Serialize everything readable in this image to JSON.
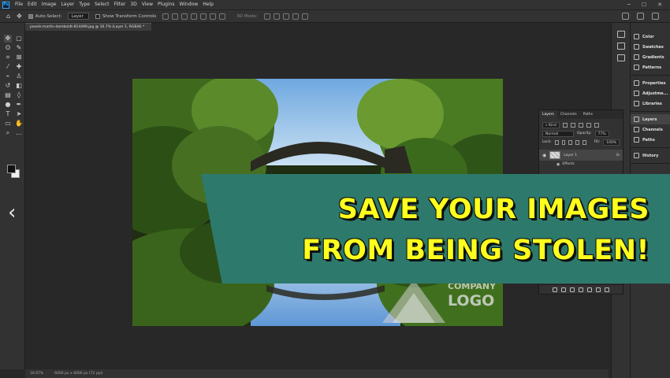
{
  "app": {
    "logo_text": "Ps"
  },
  "menubar": {
    "items": [
      "File",
      "Edit",
      "Image",
      "Layer",
      "Type",
      "Select",
      "Filter",
      "3D",
      "View",
      "Plugins",
      "Window",
      "Help"
    ]
  },
  "options_bar": {
    "auto_select_label": "Auto-Select:",
    "auto_select_target": "Layer",
    "show_transform_label": "Show Transform Controls",
    "mode_3d_label": "3D Mode:"
  },
  "document": {
    "tab_title": "pexels-martin-damboldt-814499.jpg @ 16.7% (Layer 1, RGB/8) *"
  },
  "status_bar": {
    "zoom": "16.67%",
    "dimensions": "6000 px x 4000 px (72 ppi)"
  },
  "dock_panels": {
    "group1": [
      "Color",
      "Swatches",
      "Gradients",
      "Patterns"
    ],
    "group2": [
      "Properties",
      "Adjustme...",
      "Libraries"
    ],
    "group3": [
      "Layers",
      "Channels",
      "Paths"
    ],
    "group4": [
      "History"
    ]
  },
  "layers_panel": {
    "tabs": [
      "Layers",
      "Channels",
      "Paths"
    ],
    "kind_label": "Kind",
    "blend_mode": "Normal",
    "opacity_label": "Opacity:",
    "opacity_value": "77%",
    "lock_label": "Lock:",
    "fill_label": "Fill:",
    "fill_value": "100%",
    "layer_name": "Layer 1",
    "fx_label": "fx",
    "effects_label": "Effects"
  },
  "banner": {
    "line1": "SAVE YOUR IMAGES",
    "line2": "FROM BEING STOLEN!",
    "bg_color": "#2d7a6c",
    "text_color": "#ffff1e"
  },
  "watermark": {
    "line1": "COMPANY",
    "line2": "LOGO"
  },
  "colors": {
    "ui_dark": "#282828",
    "ui_panel": "#323232",
    "ps_blue": "#31a8ff"
  }
}
